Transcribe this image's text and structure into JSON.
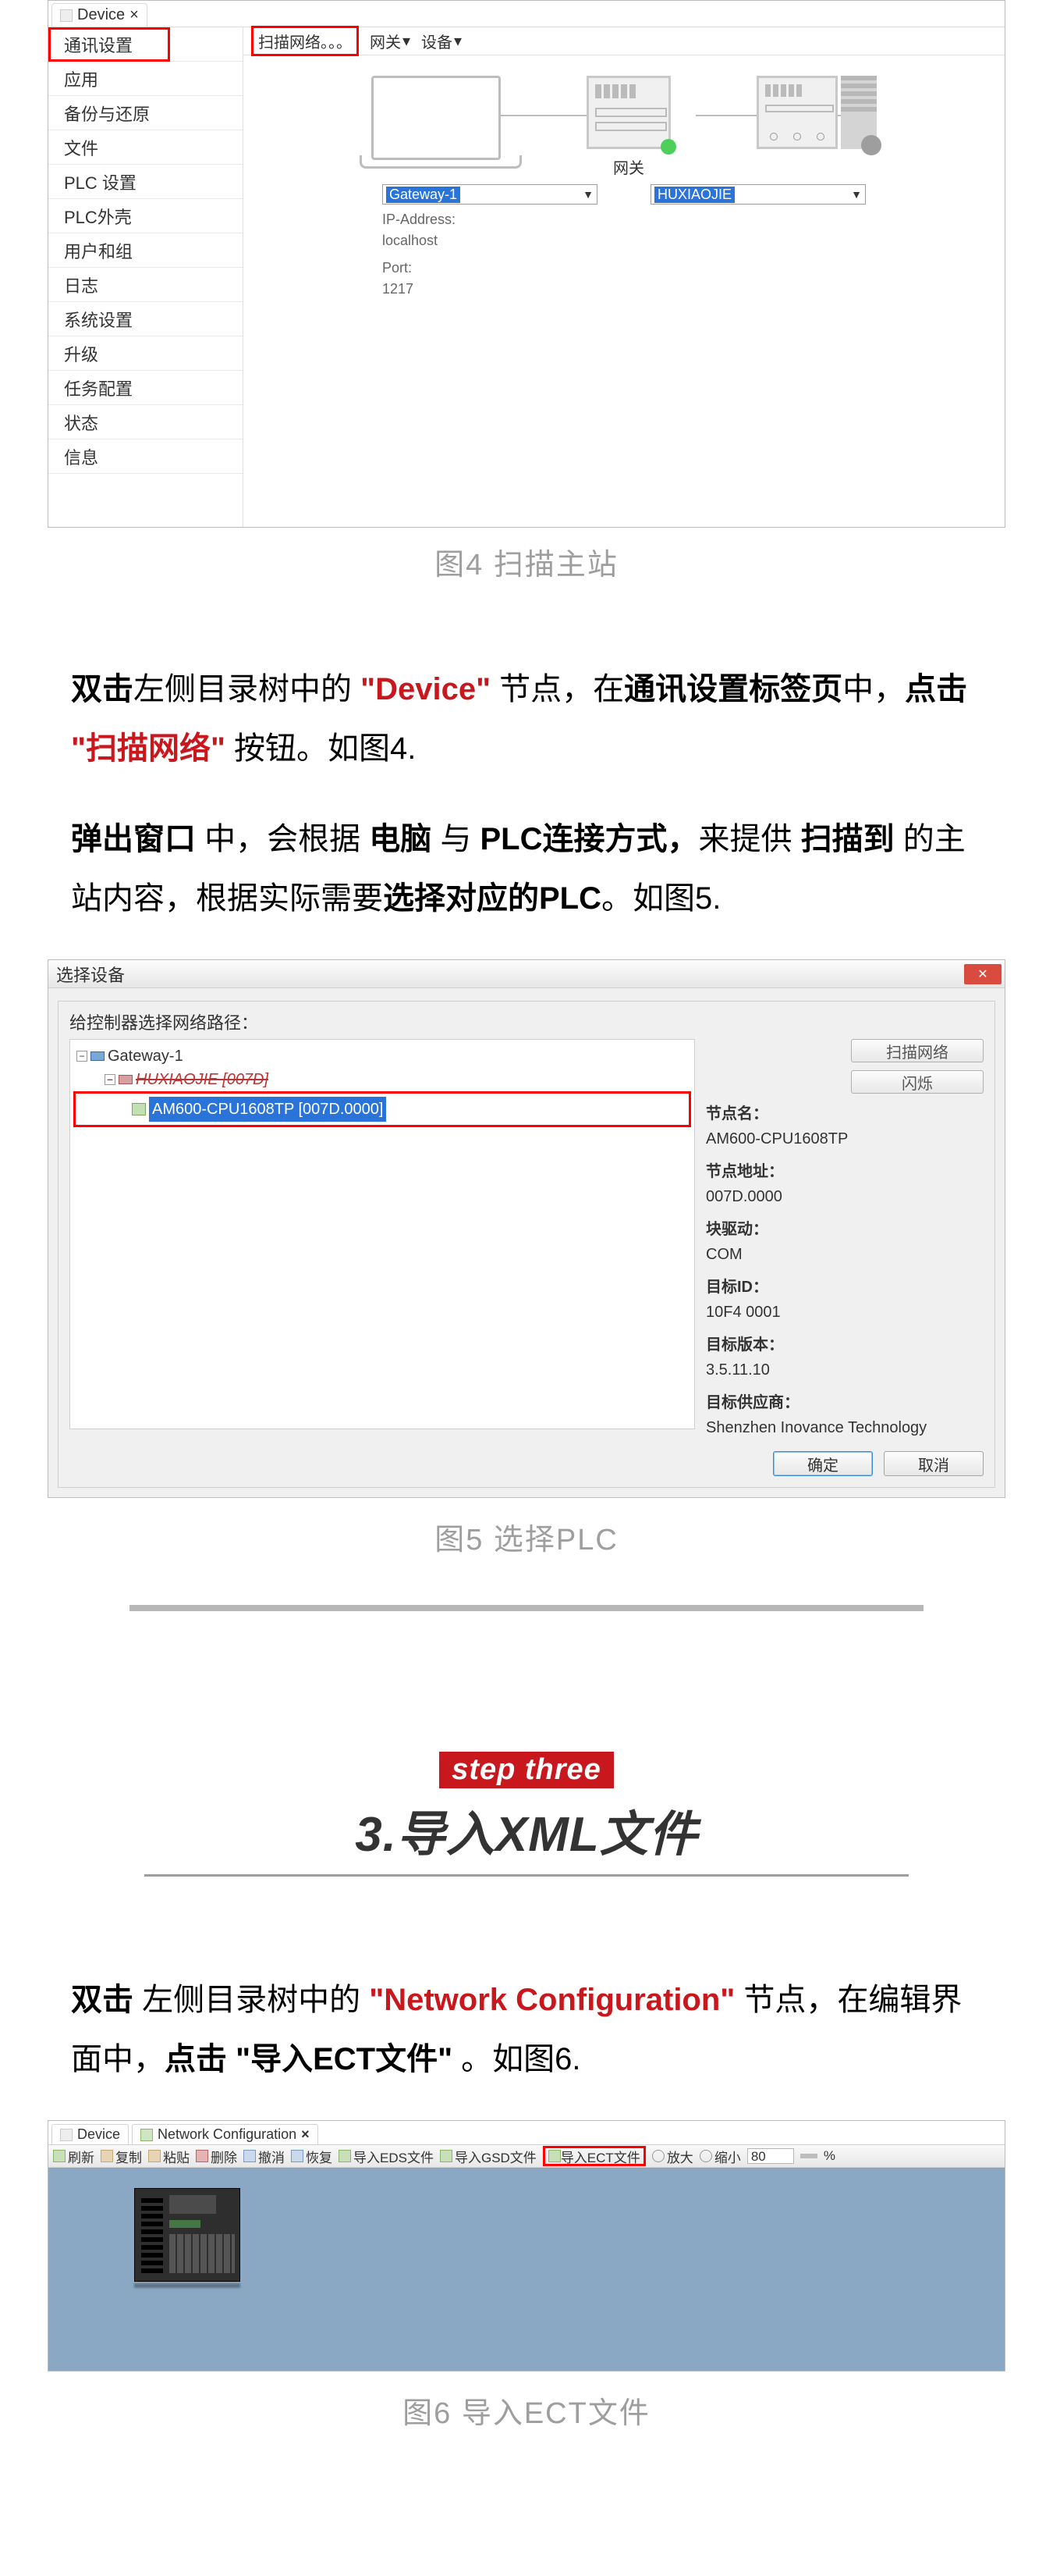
{
  "fig4": {
    "tab_title": "Device",
    "tab_close": "×",
    "sidebar": [
      "通讯设置",
      "应用",
      "备份与还原",
      "文件",
      "PLC 设置",
      "PLC外壳",
      "用户和组",
      "日志",
      "系统设置",
      "升级",
      "任务配置",
      "状态",
      "信息"
    ],
    "toolbar_scan": "扫描网络。。。",
    "toolbar_gateway": "网关",
    "toolbar_device": "设备",
    "gateway_label": "网关",
    "gw_dd_value": "Gateway-1",
    "dev_dd_value": "HUXIAOJIE",
    "info_ip_label": "IP-Address:",
    "info_ip_value": "localhost",
    "info_port_label": "Port:",
    "info_port_value": "1217",
    "caption": "图4 扫描主站"
  },
  "para1": {
    "t1": "双击",
    "t2": "左侧目录树中的 ",
    "t3": "\"Device\"",
    "t4": " 节点，在",
    "t5": "通讯设置标签页",
    "t6": "中，",
    "t7": "点击 ",
    "t8": "\"扫描网络\"",
    "t9": " 按钮。如图4."
  },
  "para2": {
    "t1": "弹出窗口",
    "t2": " 中，会根据 ",
    "t3": "电脑",
    "t4": " 与 ",
    "t5": "PLC连接方式，",
    "t6": "来提供 ",
    "t7": "扫描到",
    "t8": " 的主站内容，根据实际需要",
    "t9": "选择对应的PLC",
    "t10": "。如图5."
  },
  "fig5": {
    "title": "选择设备",
    "heading": "给控制器选择网络路径：",
    "tree_root": "Gateway-1",
    "tree_strike": "HUXIAOJIE [007D]",
    "tree_sel": "AM600-CPU1608TP [007D.0000]",
    "btn_scan": "扫描网络",
    "btn_blink": "闪烁",
    "d_name_l": "节点名：",
    "d_name_v": "AM600-CPU1608TP",
    "d_addr_l": "节点地址：",
    "d_addr_v": "007D.0000",
    "d_drv_l": "块驱动：",
    "d_drv_v": "COM",
    "d_tid_l": "目标ID：",
    "d_tid_v": "10F4 0001",
    "d_ver_l": "目标版本：",
    "d_ver_v": "3.5.11.10",
    "d_ven_l": "目标供应商：",
    "d_ven_v": "Shenzhen Inovance Technology",
    "btn_ok": "确定",
    "btn_cancel": "取消",
    "caption": "图5 选择PLC"
  },
  "step3": {
    "tag": "step three",
    "title": "3.导入XML文件"
  },
  "para3": {
    "t1": "双击",
    "t2": " 左侧目录树中的 ",
    "t3": "\"Network Configuration\"",
    "t4": " 节点，在编辑界面中，",
    "t5": "点击",
    "t6": " \"导入ECT文件\"",
    "t7": " 。如图6."
  },
  "fig6": {
    "tab1": "Device",
    "tab2": "Network Configuration",
    "tab_close": "×",
    "tb_refresh": "刷新",
    "tb_copy": "复制",
    "tb_paste": "粘贴",
    "tb_del": "删除",
    "tb_undo": "撤消",
    "tb_redo": "恢复",
    "tb_eds": "导入EDS文件",
    "tb_gsd": "导入GSD文件",
    "tb_ect": "导入ECT文件",
    "tb_zoomin": "放大",
    "tb_zoomout": "缩小",
    "tb_zoomval": "80",
    "tb_pct": "%",
    "caption": "图6 导入ECT文件"
  }
}
